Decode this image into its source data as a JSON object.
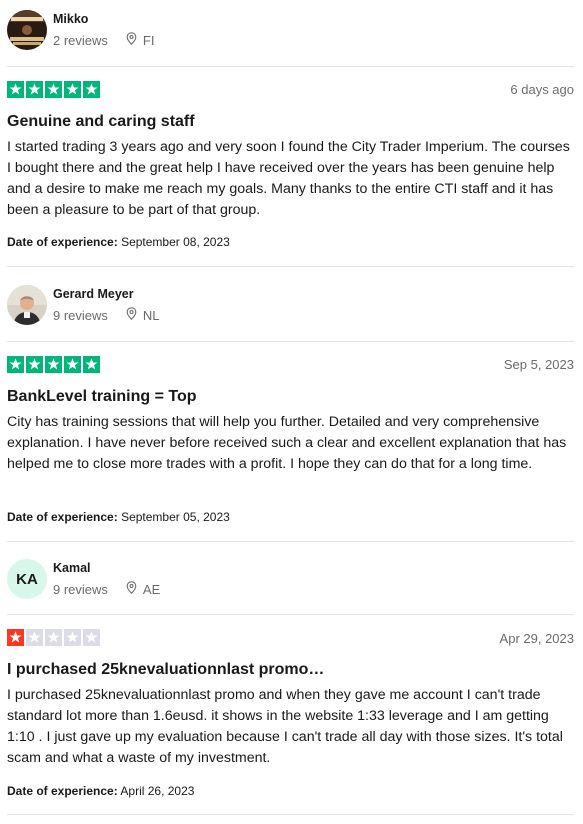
{
  "colors": {
    "star_green": "#00b67a",
    "star_red": "#ff3722",
    "star_empty": "#dcdce6"
  },
  "reviews": [
    {
      "reviewer_name": "Mikko",
      "review_count": "2 reviews",
      "country": "FI",
      "rating": 5,
      "date": "6 days ago",
      "title": "Genuine and caring staff",
      "body": "I started trading 3 years ago and very soon I found the City Trader Imperium. The courses I bought there and the great help I have received over the years has been genuine help and a desire to make me reach my goals. Many thanks to the entire CTI staff and it has been a pleasure to be part of that group.",
      "experience_label": "Date of experience:",
      "experience_date": "September 08, 2023"
    },
    {
      "reviewer_name": "Gerard Meyer",
      "review_count": "9 reviews",
      "country": "NL",
      "rating": 5,
      "date": "Sep 5, 2023",
      "title": "BankLevel training = Top",
      "body": "City has training sessions that will help you further. Detailed and very comprehensive explanation. I have never before received such a clear and excellent explanation that has helped me to close more trades with a profit. I hope they can do that for a long time.",
      "experience_label": "Date of experience:",
      "experience_date": "September 05, 2023"
    },
    {
      "reviewer_name": "Kamal",
      "avatar_initials": "KA",
      "review_count": "9 reviews",
      "country": "AE",
      "rating": 1,
      "date": "Apr 29, 2023",
      "title": "I purchased 25knevaluationnlast promo…",
      "body": "I purchased 25knevaluationnlast promo and when they gave me account I can't trade standard lot more than 1.6eusd. it shows in the website 1:33 leverage and I am getting 1:10 . I just gave up my evaluation because I can't trade all day with those sizes. It's total scam and what a waste of my investment.",
      "experience_label": "Date of experience:",
      "experience_date": "April 26, 2023"
    }
  ]
}
